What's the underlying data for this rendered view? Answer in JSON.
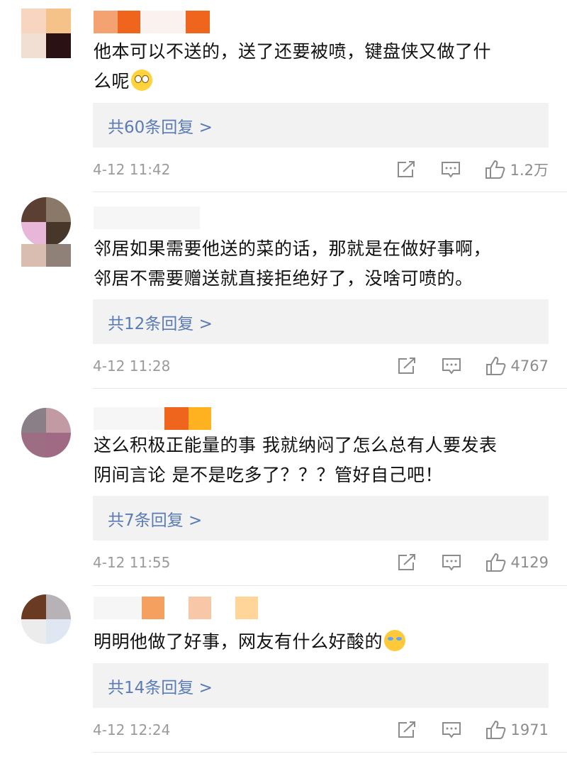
{
  "comments": [
    {
      "text_lines": [
        "他本可以不送的，送了还要被喷，键盘侠又做了什",
        "么呢"
      ],
      "emoji": "eye-roll-emoji",
      "replies_label": "共60条回复 >",
      "time": "4-12 11:42",
      "likes": "1.2万"
    },
    {
      "text_lines": [
        "邻居如果需要他送的菜的话，那就是在做好事啊，",
        "邻居不需要赠送就直接拒绝好了，没啥可喷的。"
      ],
      "replies_label": "共12条回复 >",
      "time": "4-12 11:28",
      "likes": "4767"
    },
    {
      "text_lines": [
        "这么积极正能量的事 我就纳闷了怎么总有人要发表",
        "阴间言论 是不是吃多了？？？管好自己吧！"
      ],
      "replies_label": "共7条回复 >",
      "time": "4-12 11:55",
      "likes": "4129"
    },
    {
      "text_lines": [
        "明明他做了好事，网友有什么好酸的"
      ],
      "emoji": "laughing-crying-emoji",
      "replies_label": "共14条回复 >",
      "time": "4-12 12:24",
      "likes": "1971"
    }
  ],
  "icons": {
    "share": "share-icon",
    "comment": "comment-icon",
    "like": "thumbs-up-icon"
  },
  "colors": {
    "reply_link": "#5a7bb5",
    "reply_bg": "#f2f2f2",
    "meta_gray": "#9a9a9a"
  }
}
